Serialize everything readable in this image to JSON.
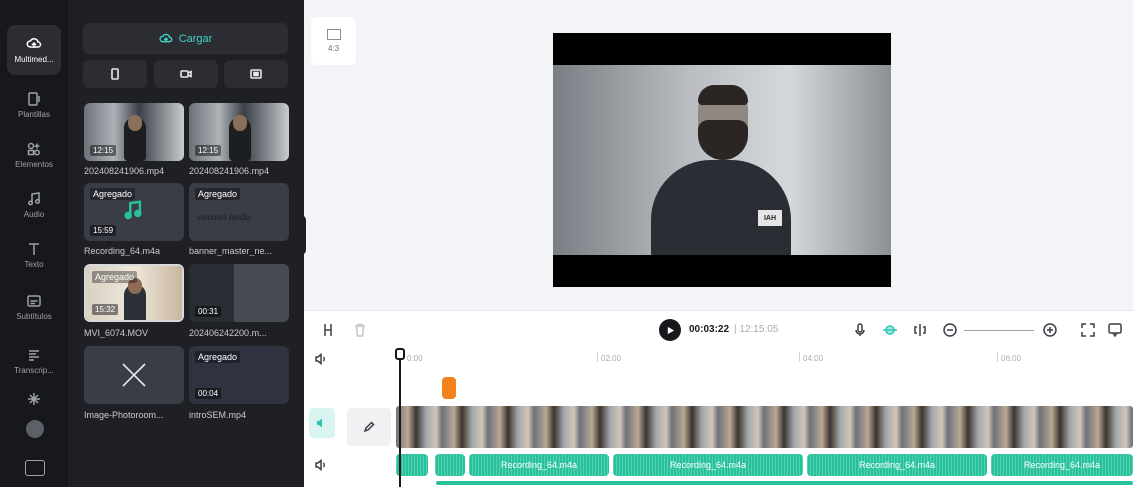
{
  "rail": {
    "items": [
      {
        "label": "Multimed...",
        "icon": "cloud-media-icon"
      },
      {
        "label": "Plantillas",
        "icon": "template-icon"
      },
      {
        "label": "Elementos",
        "icon": "elements-icon"
      },
      {
        "label": "Audio",
        "icon": "music-note-icon"
      },
      {
        "label": "Texto",
        "icon": "text-icon"
      },
      {
        "label": "Subtítulos",
        "icon": "subtitles-icon"
      },
      {
        "label": "Transcrip...",
        "icon": "transcript-icon"
      }
    ]
  },
  "panel": {
    "upload_label": "Cargar",
    "cards": [
      {
        "name": "202408241906.mp4",
        "duration": "12:15",
        "added": ""
      },
      {
        "name": "202408241906.mp4",
        "duration": "12:15",
        "added": ""
      },
      {
        "name": "Recording_64.m4a",
        "duration": "15:59",
        "added": "Agregado"
      },
      {
        "name": "banner_master_ne...",
        "duration": "",
        "added": "Agregado",
        "watermark": "somosel media"
      },
      {
        "name": "MVI_6074.MOV",
        "duration": "15:32",
        "added": "Agregado"
      },
      {
        "name": "202406242200.m...",
        "duration": "00:31",
        "added": ""
      },
      {
        "name": "Image-Photoroom...",
        "duration": "",
        "added": ""
      },
      {
        "name": "introSEM.mp4",
        "duration": "00:04",
        "added": "Agregado"
      }
    ]
  },
  "preview": {
    "ratio_label": "4:3",
    "shirt_logo": "IAH"
  },
  "toolbar": {
    "current_time": "00:03:22",
    "separator": "|",
    "total_time": "12:15:05"
  },
  "timeline": {
    "ruler": [
      "0:00",
      "02:00",
      "04:00",
      "06:00"
    ],
    "audio_clips": [
      "Recording_64.m4a",
      "Recording_64.m4a",
      "Recording_64.m4a",
      "Recording_64.m4a"
    ]
  },
  "colors": {
    "accent": "#43d2c8",
    "audio": "#27c29c",
    "marker": "#f2811e",
    "rail_bg": "#17181c",
    "panel_bg": "#1f2025"
  }
}
